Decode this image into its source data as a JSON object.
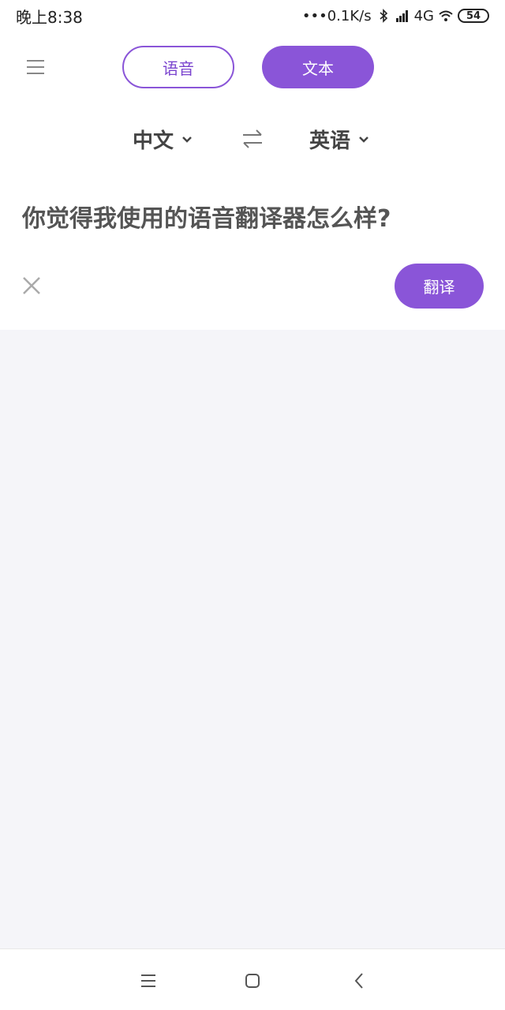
{
  "status_bar": {
    "time": "晚上8:38",
    "network_speed": "•••0.1K/s",
    "network_type": "4G",
    "battery_level": "54"
  },
  "modes": {
    "voice_label": "语音",
    "text_label": "文本",
    "active": "text"
  },
  "languages": {
    "source": "中文",
    "target": "英语"
  },
  "input": {
    "text": "你觉得我使用的语音翻译器怎么样?"
  },
  "actions": {
    "translate_label": "翻译"
  },
  "colors": {
    "accent": "#8a55d8",
    "background_result": "#f5f5f9"
  },
  "icons": {
    "menu": "menu-icon",
    "swap": "swap-languages-icon",
    "clear": "close-icon",
    "nav_menu": "nav-menu-icon",
    "nav_home": "nav-home-icon",
    "nav_back": "nav-back-icon"
  }
}
